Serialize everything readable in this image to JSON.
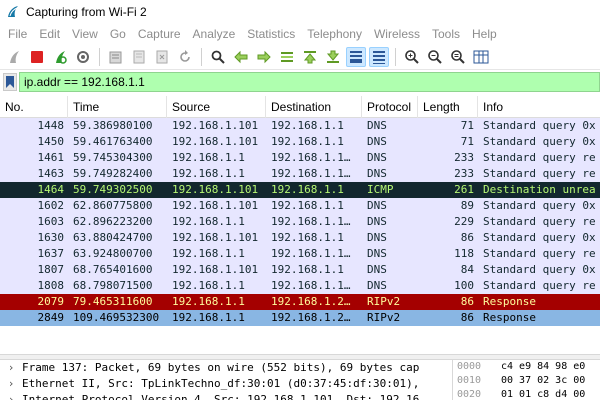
{
  "window": {
    "title": "Capturing from Wi-Fi 2"
  },
  "menu": [
    "File",
    "Edit",
    "View",
    "Go",
    "Capture",
    "Analyze",
    "Statistics",
    "Telephony",
    "Wireless",
    "Tools",
    "Help"
  ],
  "toolbar": {
    "icons": [
      "start-capture-icon",
      "stop-capture-icon",
      "restart-capture-icon",
      "capture-options-icon",
      "open-file-icon",
      "save-file-icon",
      "close-file-icon",
      "reload-icon",
      "find-packet-icon",
      "go-back-icon",
      "go-forward-icon",
      "go-to-packet-icon",
      "first-packet-icon",
      "last-packet-icon",
      "autoscroll-icon",
      "colorize-icon",
      "zoom-in-icon",
      "zoom-out-icon",
      "normal-size-icon",
      "resize-columns-icon"
    ]
  },
  "filter": {
    "value": "ip.addr == 192.168.1.1"
  },
  "columns": [
    "No.",
    "Time",
    "Source",
    "Destination",
    "Protocol",
    "Length",
    "Info"
  ],
  "packets": [
    {
      "no": "1448",
      "time": "59.386980100",
      "src": "192.168.1.101",
      "dst": "192.168.1.1",
      "proto": "DNS",
      "len": "71",
      "info": "Standard query 0x",
      "style": "light"
    },
    {
      "no": "1450",
      "time": "59.461763400",
      "src": "192.168.1.101",
      "dst": "192.168.1.1",
      "proto": "DNS",
      "len": "71",
      "info": "Standard query 0x",
      "style": "light"
    },
    {
      "no": "1461",
      "time": "59.745304300",
      "src": "192.168.1.1",
      "dst": "192.168.1.1…",
      "proto": "DNS",
      "len": "233",
      "info": "Standard query re",
      "style": "light"
    },
    {
      "no": "1463",
      "time": "59.749282400",
      "src": "192.168.1.1",
      "dst": "192.168.1.1…",
      "proto": "DNS",
      "len": "233",
      "info": "Standard query re",
      "style": "light"
    },
    {
      "no": "1464",
      "time": "59.749302500",
      "src": "192.168.1.101",
      "dst": "192.168.1.1",
      "proto": "ICMP",
      "len": "261",
      "info": "Destination unrea",
      "style": "icmp"
    },
    {
      "no": "1602",
      "time": "62.860775800",
      "src": "192.168.1.101",
      "dst": "192.168.1.1",
      "proto": "DNS",
      "len": "89",
      "info": "Standard query 0x",
      "style": "light"
    },
    {
      "no": "1603",
      "time": "62.896223200",
      "src": "192.168.1.1",
      "dst": "192.168.1.1…",
      "proto": "DNS",
      "len": "229",
      "info": "Standard query re",
      "style": "light"
    },
    {
      "no": "1630",
      "time": "63.880424700",
      "src": "192.168.1.101",
      "dst": "192.168.1.1",
      "proto": "DNS",
      "len": "86",
      "info": "Standard query 0x",
      "style": "light"
    },
    {
      "no": "1637",
      "time": "63.924800700",
      "src": "192.168.1.1",
      "dst": "192.168.1.1…",
      "proto": "DNS",
      "len": "118",
      "info": "Standard query re",
      "style": "light"
    },
    {
      "no": "1807",
      "time": "68.765401600",
      "src": "192.168.1.101",
      "dst": "192.168.1.1",
      "proto": "DNS",
      "len": "84",
      "info": "Standard query 0x",
      "style": "light"
    },
    {
      "no": "1808",
      "time": "68.798071500",
      "src": "192.168.1.1",
      "dst": "192.168.1.1…",
      "proto": "DNS",
      "len": "100",
      "info": "Standard query re",
      "style": "light"
    },
    {
      "no": "2079",
      "time": "79.465311600",
      "src": "192.168.1.1",
      "dst": "192.168.1.2…",
      "proto": "RIPv2",
      "len": "86",
      "info": "Response",
      "style": "red"
    },
    {
      "no": "2849",
      "time": "109.469532300",
      "src": "192.168.1.1",
      "dst": "192.168.1.2…",
      "proto": "RIPv2",
      "len": "86",
      "info": "Response",
      "style": "blue"
    }
  ],
  "details": [
    "Frame 137: Packet, 69 bytes on wire (552 bits), 69 bytes cap",
    "Ethernet II, Src: TpLinkTechno_df:30:01 (d0:37:45:df:30:01),",
    "Internet Protocol Version 4, Src: 192.168.1.101, Dst: 192.16"
  ],
  "hex": [
    {
      "offset": "0000",
      "bytes": "c4 e9 84 98 e0"
    },
    {
      "offset": "0010",
      "bytes": "00 37 02 3c 00"
    },
    {
      "offset": "0020",
      "bytes": "01 01 c8 d4 00"
    }
  ],
  "colors": {
    "light_row": "#e7e6ff",
    "light_row_text": "#12272e",
    "icmp_row": "#12272e",
    "icmp_row_text": "#b7f774",
    "red_row": "#a40000",
    "red_row_text": "#fffc9c",
    "blue_row": "#89b6e3",
    "blue_row_text": "#000000",
    "filter_bg": "#afffaf"
  }
}
